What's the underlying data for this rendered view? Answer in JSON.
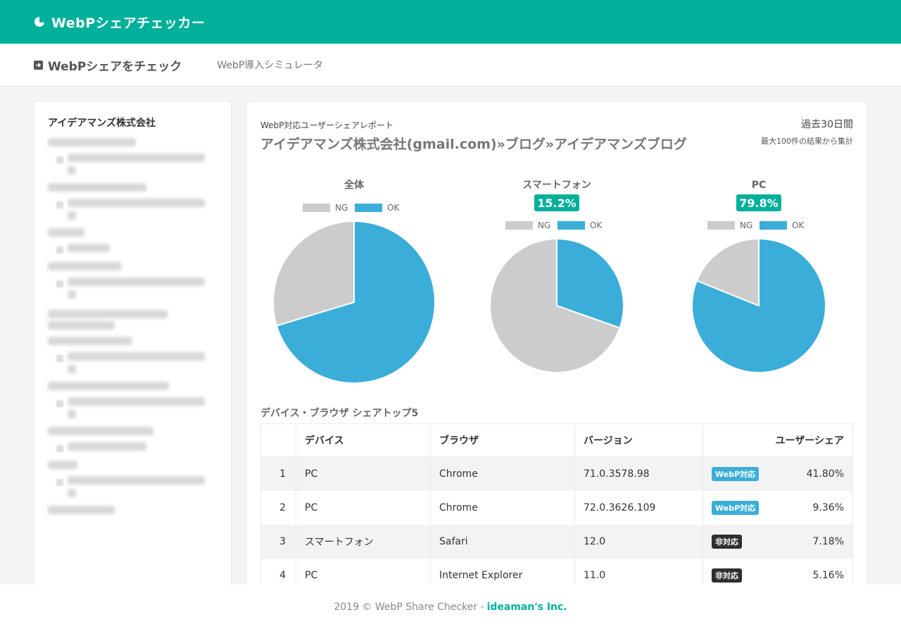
{
  "header": {
    "brand": "WebPシェアチェッカー",
    "brand_icon": "pie-chart-icon"
  },
  "nav": {
    "active": "WebPシェアをチェック",
    "item2": "WebP導入シミュレータ"
  },
  "sidebar": {
    "title": "アイデアマンズ株式会社"
  },
  "report": {
    "label": "WebP対応ユーザーシェアレポート",
    "title": "アイデアマンズ株式会社(gmail.com)»ブログ»アイデアマンズブログ",
    "period": "過去30日間",
    "period_note": "最大100件の結果から集計"
  },
  "colors": {
    "accent": "#00b09b",
    "ok": "#3aaed9",
    "ng": "#cccccc"
  },
  "chart_data": [
    {
      "type": "pie",
      "title": "全体",
      "categories": [
        "NG",
        "OK"
      ],
      "values": [
        29.7,
        70.3
      ],
      "legend": "top"
    },
    {
      "type": "pie",
      "title": "スマートフォン",
      "badge": "15.2%",
      "categories": [
        "NG",
        "OK"
      ],
      "values": [
        69.6,
        30.4
      ],
      "legend": "top"
    },
    {
      "type": "pie",
      "title": "PC",
      "badge": "79.8%",
      "categories": [
        "NG",
        "OK"
      ],
      "values": [
        18.9,
        81.1
      ],
      "legend": "top"
    }
  ],
  "table": {
    "heading": "デバイス・ブラウザ シェアトップ5",
    "columns": [
      "",
      "デバイス",
      "ブラウザ",
      "バージョン",
      "ユーザーシェア"
    ],
    "rows": [
      {
        "rank": "1",
        "device": "PC",
        "browser": "Chrome",
        "version": "71.0.3578.98",
        "badge": "WebP対応",
        "badge_type": "ok",
        "share": "41.80%"
      },
      {
        "rank": "2",
        "device": "PC",
        "browser": "Chrome",
        "version": "72.0.3626.109",
        "badge": "WebP対応",
        "badge_type": "ok",
        "share": "9.36%"
      },
      {
        "rank": "3",
        "device": "スマートフォン",
        "browser": "Safari",
        "version": "12.0",
        "badge": "非対応",
        "badge_type": "ng",
        "share": "7.18%"
      },
      {
        "rank": "4",
        "device": "PC",
        "browser": "Internet Explorer",
        "version": "11.0",
        "badge": "非対応",
        "badge_type": "ng",
        "share": "5.16%"
      }
    ]
  },
  "footer": {
    "text": "2019 © WebP Share Checker -",
    "link": "ideaman's Inc."
  }
}
